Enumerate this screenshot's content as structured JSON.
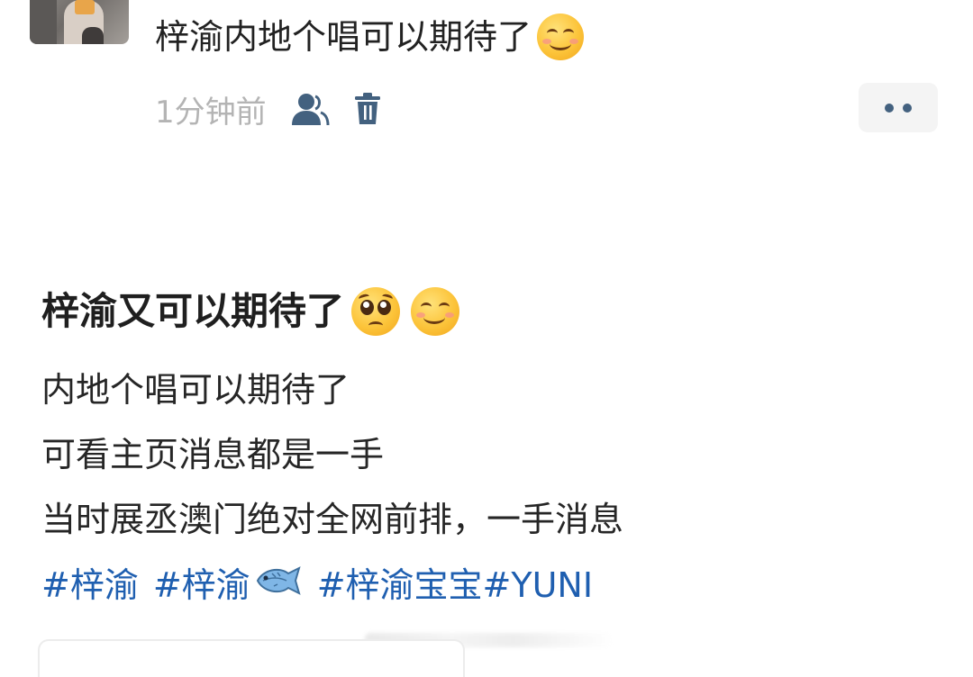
{
  "comment": {
    "text": "梓渝内地个唱可以期待了",
    "emoji": "smiling-face-emoji",
    "time": "1分钟前"
  },
  "post": {
    "title": "梓渝又可以期待了",
    "title_emojis": [
      "pleading-face-emoji",
      "smiling-face-emoji"
    ],
    "lines": [
      "内地个唱可以期待了",
      "可看主页消息都是一手",
      "当时展丞澳门绝对全网前排，一手消息"
    ],
    "tags": [
      "#梓渝",
      "#梓渝",
      "#梓渝宝宝",
      "#YUNI"
    ],
    "tag_color": "#1f5fb0"
  },
  "icons": {
    "user": "user-icon",
    "delete": "trash-icon",
    "more": "more-icon",
    "fish": "fish-emoji"
  }
}
